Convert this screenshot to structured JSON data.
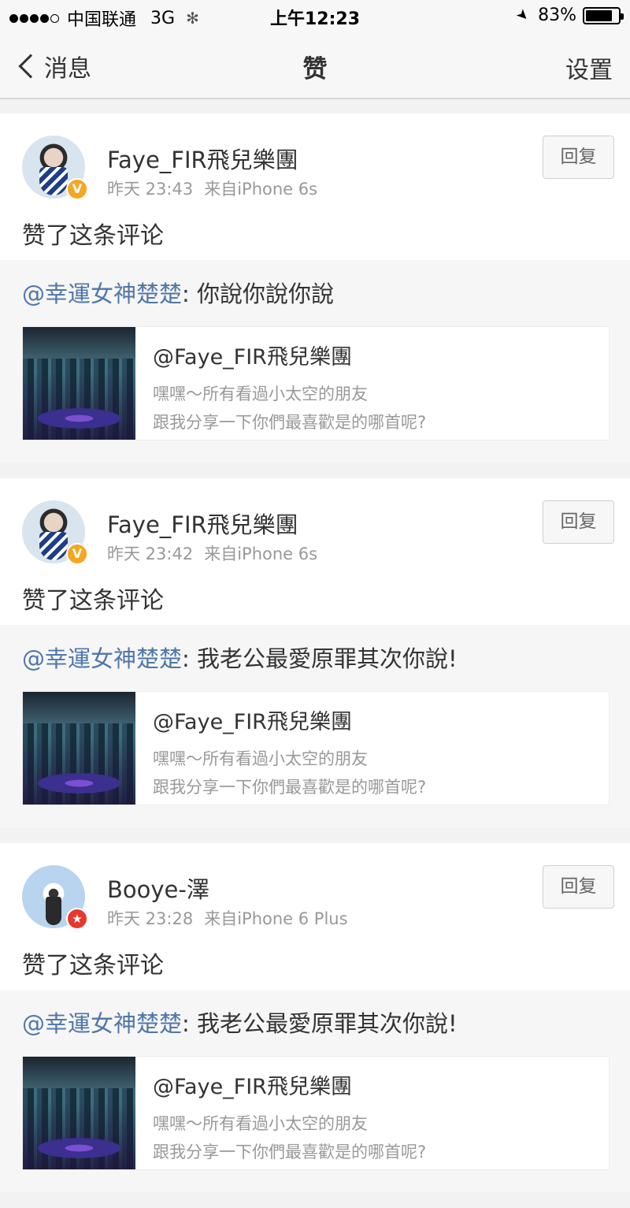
{
  "status_bar": {
    "carrier": "中国联通",
    "network": "3G",
    "time": "上午12:23",
    "battery_pct": "83%",
    "battery_level": 0.83
  },
  "nav": {
    "back_label": "消息",
    "title": "赞",
    "settings_label": "设置"
  },
  "items": [
    {
      "user": "Faye_FIR飛兒樂團",
      "time": "昨天 23:43",
      "source": "来自iPhone 6s",
      "reply_label": "回复",
      "action": "赞了这条评论",
      "badge": "V",
      "mention": "@幸運女神楚楚",
      "comment": ": 你說你說你說",
      "ref_title": "@Faye_FIR飛兒樂團",
      "ref_line1": "嘿嘿～所有看過小太空的朋友",
      "ref_line2": "跟我分享一下你們最喜歡是的哪首呢?"
    },
    {
      "user": "Faye_FIR飛兒樂團",
      "time": "昨天 23:42",
      "source": "来自iPhone 6s",
      "reply_label": "回复",
      "action": "赞了这条评论",
      "badge": "V",
      "mention": "@幸運女神楚楚",
      "comment": ": 我老公最愛原罪其次你說!",
      "ref_title": "@Faye_FIR飛兒樂團",
      "ref_line1": "嘿嘿～所有看過小太空的朋友",
      "ref_line2": "跟我分享一下你們最喜歡是的哪首呢?"
    },
    {
      "user": "Booye-澤",
      "time": "昨天 23:28",
      "source": "来自iPhone 6 Plus",
      "reply_label": "回复",
      "action": "赞了这条评论",
      "badge": "★",
      "mention": "@幸運女神楚楚",
      "comment": ": 我老公最愛原罪其次你說!",
      "ref_title": "@Faye_FIR飛兒樂團",
      "ref_line1": "嘿嘿～所有看過小太空的朋友",
      "ref_line2": "跟我分享一下你們最喜歡是的哪首呢?"
    }
  ]
}
